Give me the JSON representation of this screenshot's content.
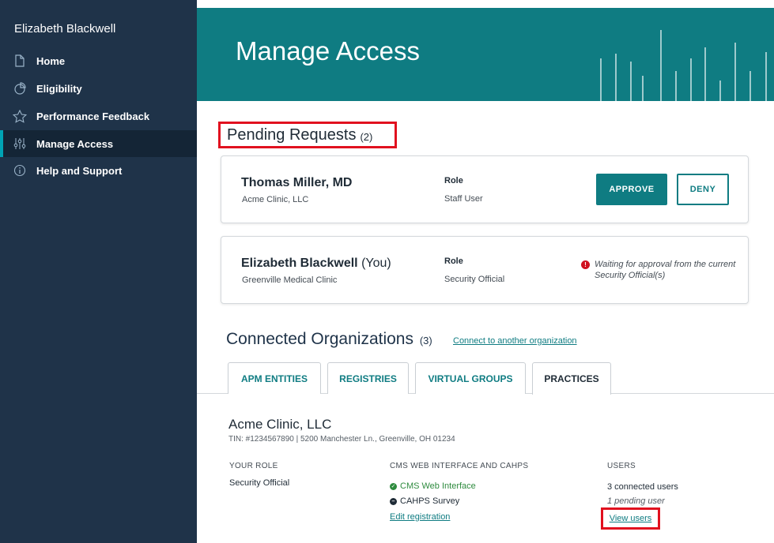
{
  "sidebar": {
    "user_name": "Elizabeth Blackwell",
    "items": [
      {
        "label": "Home",
        "icon": "home-icon"
      },
      {
        "label": "Eligibility",
        "icon": "pie-chart-icon"
      },
      {
        "label": "Performance Feedback",
        "icon": "star-icon"
      },
      {
        "label": "Manage Access",
        "icon": "sliders-icon",
        "active": true
      },
      {
        "label": "Help and Support",
        "icon": "info-icon"
      }
    ]
  },
  "banner": {
    "title": "Manage Access"
  },
  "pending": {
    "heading": "Pending Requests",
    "count": "(2)",
    "requests": [
      {
        "name": "Thomas Miller, MD",
        "org": "Acme Clinic, LLC",
        "role_label": "Role",
        "role": "Staff User",
        "approve": "APPROVE",
        "deny": "DENY"
      },
      {
        "name": "Elizabeth Blackwell",
        "you": "(You)",
        "org": "Greenville Medical Clinic",
        "role_label": "Role",
        "role": "Security Official",
        "status": "Waiting for approval from the current Security Official(s)"
      }
    ]
  },
  "connected": {
    "heading": "Connected Organizations",
    "count": "(3)",
    "link": "Connect to another organization",
    "tabs": [
      "APM ENTITIES",
      "REGISTRIES",
      "VIRTUAL GROUPS",
      "PRACTICES"
    ],
    "active_tab": "PRACTICES"
  },
  "practice": {
    "name": "Acme Clinic, LLC",
    "meta": "TIN: #1234567890  |  5200 Manchester Ln., Greenville, OH 01234",
    "your_role_header": "YOUR ROLE",
    "your_role": "Security Official",
    "cms_header": "CMS WEB INTERFACE AND CAHPS",
    "cms_web": "CMS Web Interface",
    "cahps": "CAHPS Survey",
    "edit_link": "Edit registration",
    "users_header": "USERS",
    "connected_users": "3 connected users",
    "pending_users": "1 pending user",
    "view_users": "View users"
  },
  "colors": {
    "sidebar": "#1f3349",
    "accent": "#0f7c82",
    "highlight": "#e1111f",
    "success": "#2e8b3e"
  }
}
